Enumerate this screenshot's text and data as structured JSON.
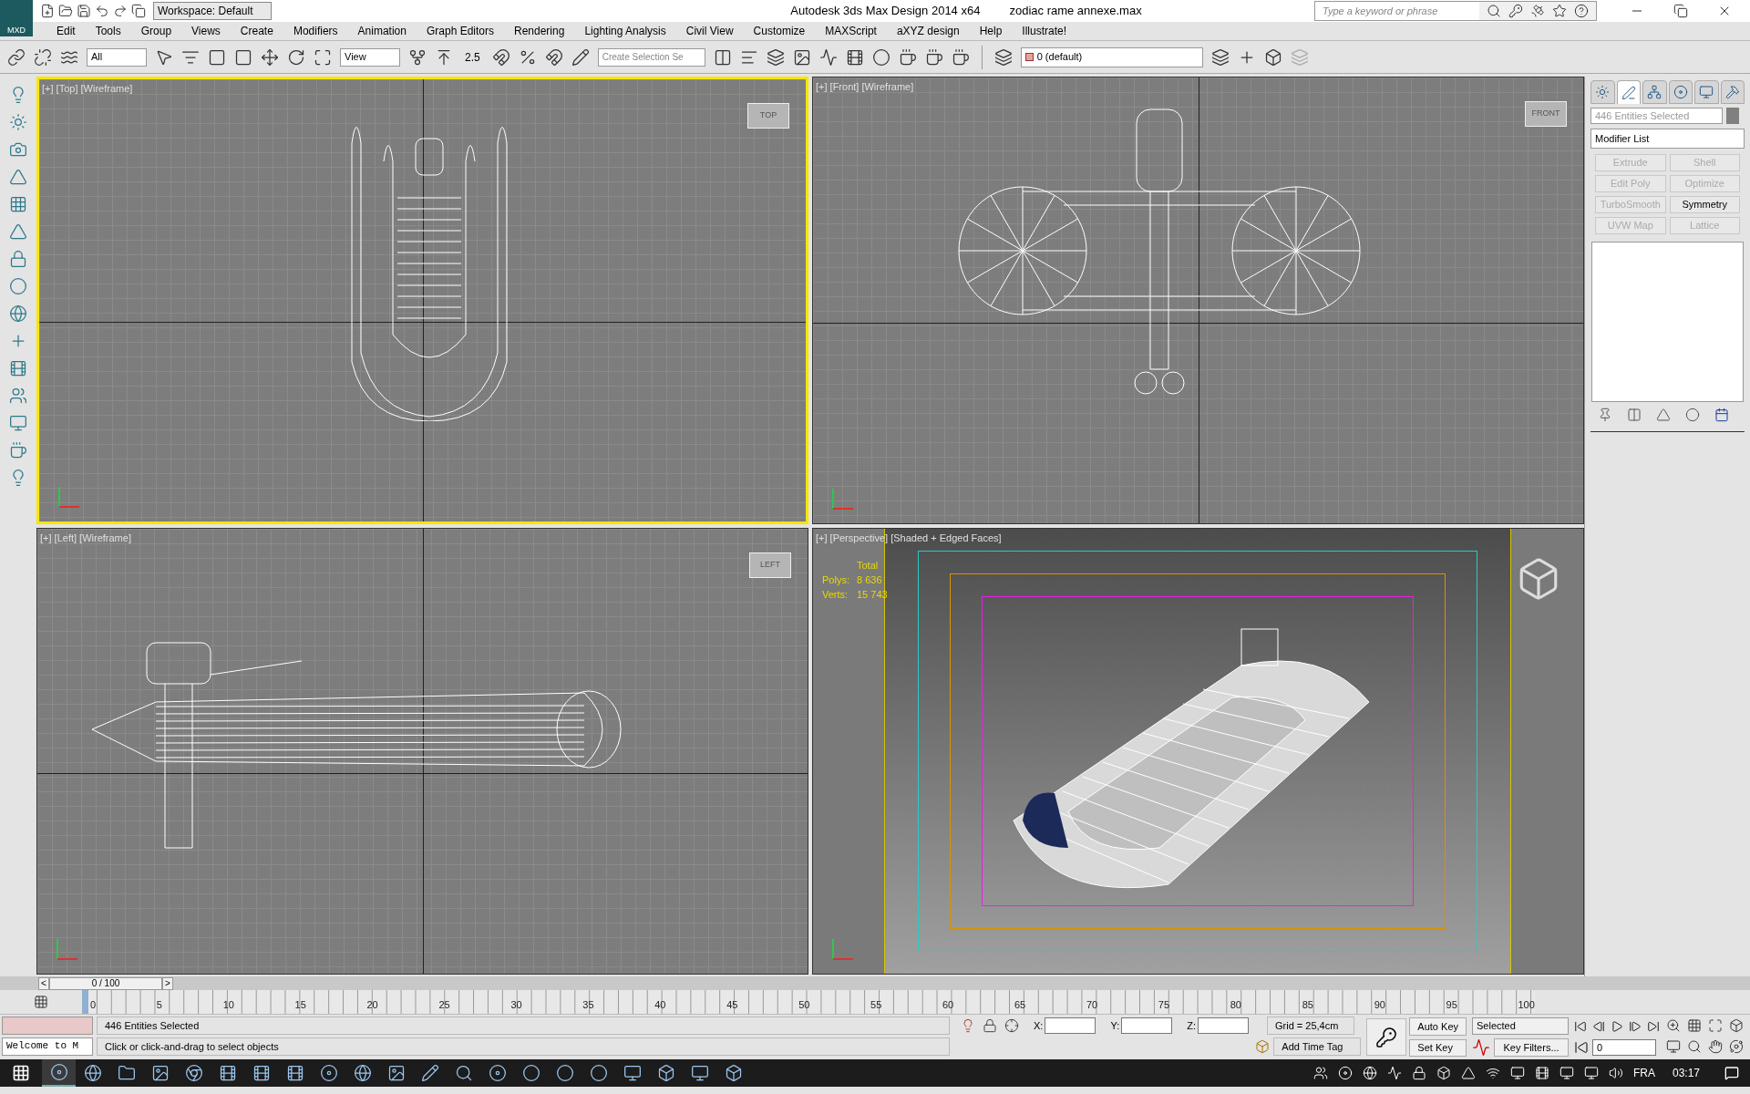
{
  "window": {
    "app_title": "Autodesk 3ds Max Design 2014 x64",
    "file_name": "zodiac rame annexe.max",
    "logo": "MXD",
    "workspace": "Workspace: Default",
    "search": {
      "placeholder": "Type a keyword or phrase"
    }
  },
  "menu": [
    "Edit",
    "Tools",
    "Group",
    "Views",
    "Create",
    "Modifiers",
    "Animation",
    "Graph Editors",
    "Rendering",
    "Lighting Analysis",
    "Civil View",
    "Customize",
    "MAXScript",
    "aXYZ design",
    "Help",
    "Illustrate!"
  ],
  "toolbar": {
    "selection_filter": "All",
    "reference_coord": "View",
    "snap_value": "2.5",
    "named_selection": {
      "placeholder": "Create Selection Se"
    },
    "layer": "0 (default)"
  },
  "viewports": [
    {
      "kind": "top",
      "label": "[+] [Top] [Wireframe]",
      "cube": "TOP",
      "selected": true
    },
    {
      "kind": "front",
      "label": "[+] [Front] [Wireframe]",
      "cube": "FRONT",
      "selected": false
    },
    {
      "kind": "left",
      "label": "[+] [Left] [Wireframe]",
      "cube": "LEFT",
      "selected": false
    },
    {
      "kind": "perspective",
      "label": "[+] [Perspective] [Shaded + Edged Faces]",
      "selected": false,
      "stats": {
        "header": "Total",
        "rows": [
          {
            "label": "Polys:",
            "value": "8 636"
          },
          {
            "label": "Verts:",
            "value": "15 743"
          }
        ]
      }
    }
  ],
  "command_panel": {
    "tabs": [
      {
        "selected": false
      },
      {
        "selected": true
      },
      {
        "selected": false
      },
      {
        "selected": false
      },
      {
        "selected": false
      },
      {
        "selected": false
      }
    ],
    "name_field": "446 Entities Selected",
    "modifier_list": "Modifier List",
    "modifier_buttons": [
      {
        "label": "Extrude",
        "disabled": true
      },
      {
        "label": "Shell",
        "disabled": true
      },
      {
        "label": "Edit Poly",
        "disabled": true
      },
      {
        "label": "Optimize",
        "disabled": true
      },
      {
        "label": "TurboSmooth",
        "disabled": true
      },
      {
        "label": "Symmetry",
        "disabled": false
      },
      {
        "label": "UVW Map",
        "disabled": true
      },
      {
        "label": "Lattice",
        "disabled": true
      }
    ]
  },
  "timeline": {
    "slider": "0 / 100",
    "level": 0,
    "prev": "<",
    "next": ">",
    "ticks": [
      "0",
      "5",
      "10",
      "15",
      "20",
      "25",
      "30",
      "35",
      "40",
      "45",
      "50",
      "55",
      "60",
      "65",
      "70",
      "75",
      "80",
      "85",
      "90",
      "95",
      "100"
    ]
  },
  "status_bar": {
    "listener": "Welcome to M",
    "selection": "446 Entities Selected",
    "prompt": "Click or click-and-drag to select objects",
    "x_label": "X:",
    "y_label": "Y:",
    "z_label": "Z:",
    "grid": "Grid = 25,4cm",
    "add_time_tag": "Add Time Tag",
    "auto_key": "Auto Key",
    "set_key": "Set Key",
    "key_mode": "Selected",
    "key_filters": "Key Filters...",
    "frame": "0"
  },
  "taskbar": {
    "language": "FRA",
    "clock": "03:17"
  }
}
